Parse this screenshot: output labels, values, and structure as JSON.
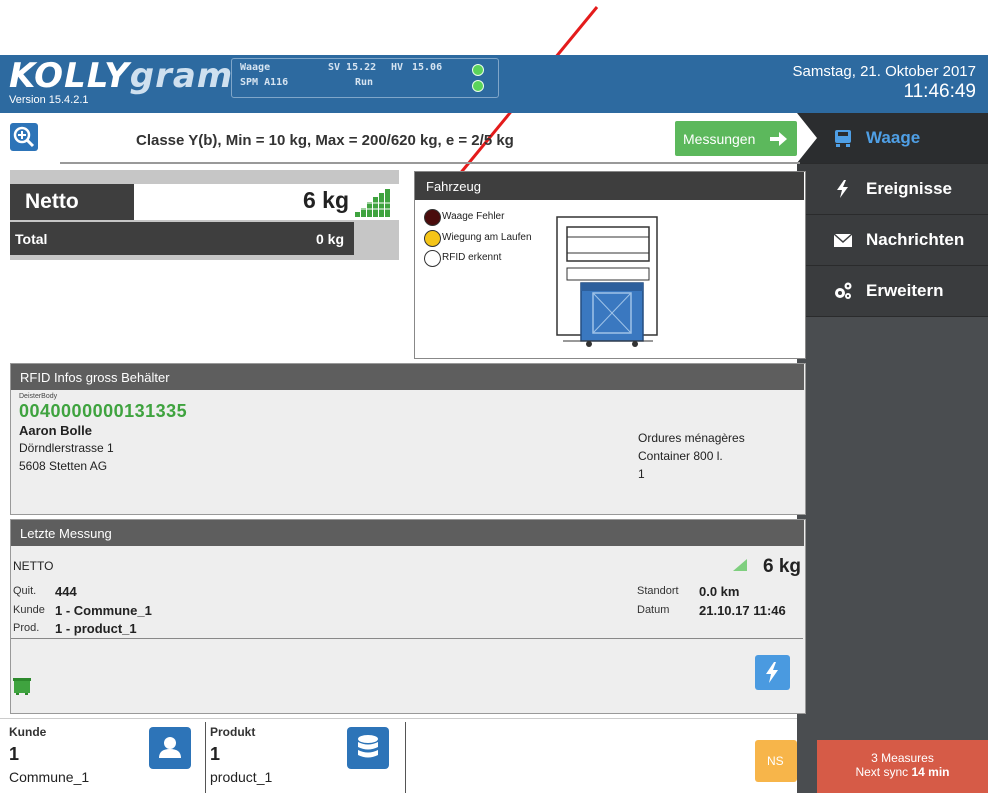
{
  "header": {
    "logo_main": "KOLLY",
    "logo_sub": "gram",
    "version": "Version 15.4.2.1",
    "device_line1": "Waage",
    "device_line2": "SPM A116",
    "sv_label": "SV 15.22",
    "hv_label": "HV",
    "hv_value": "15.06",
    "run_label": "Run",
    "date": "Samstag, 21. Oktober 2017",
    "time": "11:46:49"
  },
  "classbar": {
    "text": "Classe Y(b), Min = 10 kg, Max = 200/620 kg, e = 2/5 kg",
    "button_label": "Messungen"
  },
  "nav": {
    "items": [
      {
        "label": "Waage",
        "icon": "scale-icon",
        "active": true
      },
      {
        "label": "Ereignisse",
        "icon": "lightning-icon"
      },
      {
        "label": "Nachrichten",
        "icon": "envelope-icon"
      },
      {
        "label": "Erweitern",
        "icon": "gears-icon"
      }
    ]
  },
  "netto": {
    "label": "Netto",
    "value": "6 kg",
    "total_label": "Total",
    "total_value": "0 kg"
  },
  "fahrzeug": {
    "title": "Fahrzeug",
    "status": [
      {
        "label": "Waage Fehler",
        "color": "#4a0c0c"
      },
      {
        "label": "Wiegung am Laufen",
        "color": "#f5c518"
      },
      {
        "label": "RFID erkennt",
        "color": "#ffffff"
      }
    ]
  },
  "rfid": {
    "title": "RFID Infos gross Behälter",
    "source": "DeisterBody",
    "tag": "0040000000131335",
    "name": "Aaron Bolle",
    "street": "Dörndlerstrasse 1",
    "city": "5608 Stetten AG",
    "waste_type": "Ordures ménagères",
    "container": "Container 800 l.",
    "count": "1"
  },
  "letzte": {
    "title": "Letzte Messung",
    "type": "NETTO",
    "value": "6 kg",
    "quit_label": "Quit.",
    "quit_value": "444",
    "kunde_label": "Kunde",
    "kunde_value": "1 - Commune_1",
    "prod_label": "Prod.",
    "prod_value": "1 - product_1",
    "standort_label": "Standort",
    "standort_value": "0.0 km",
    "datum_label": "Datum",
    "datum_value": "21.10.17 11:46"
  },
  "bottom": {
    "kunde_label": "Kunde",
    "kunde_num": "1",
    "kunde_name": "Commune_1",
    "produkt_label": "Produkt",
    "produkt_num": "1",
    "produkt_name": "product_1",
    "ns_label": "NS",
    "sync_line1": "3 Measures",
    "sync_prefix": "Next sync",
    "sync_time": "14 min"
  },
  "colors": {
    "header_blue": "#2d6aa0",
    "accent_green": "#3fa33f",
    "nav_active": "#4f9fe5",
    "sync_red": "#d65b47"
  }
}
